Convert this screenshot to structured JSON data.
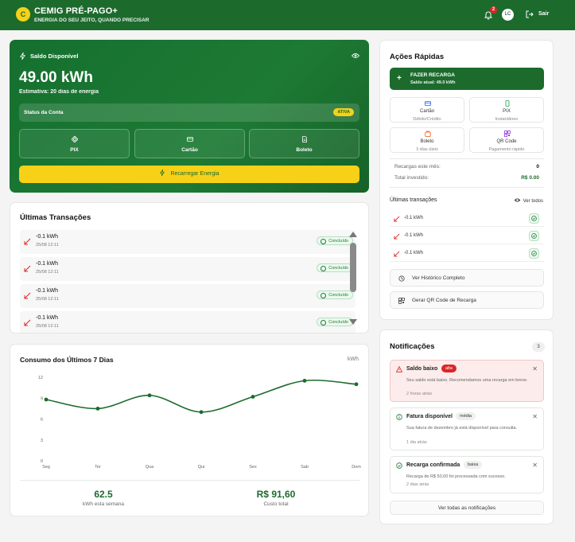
{
  "header": {
    "logo_letter": "C",
    "title": "CEMIG PRÉ-PAGO+",
    "subtitle": "ENERGIA DO SEU JEITO, QUANDO PRECISAR",
    "notification_count": "2",
    "avatar_initials": "LC",
    "logout_label": "Sair"
  },
  "balance": {
    "label": "Saldo Disponível",
    "value": "49.00 kWh",
    "estimate": "Estimativa: 20 dias de energia",
    "status_label": "Status da Conta",
    "status_badge": "ATIVA",
    "payment_buttons": [
      "PIX",
      "Cartão",
      "Boleto"
    ],
    "recharge_label": "Recarregar Energia"
  },
  "transactions": {
    "title": "Últimas Transações",
    "items": [
      {
        "amount": "-0.1 kWh",
        "date": "25/08 12:11",
        "status": "Concluído"
      },
      {
        "amount": "-0.1 kWh",
        "date": "25/08 12:11",
        "status": "Concluído"
      },
      {
        "amount": "-0.1 kWh",
        "date": "25/08 12:11",
        "status": "Concluído"
      },
      {
        "amount": "-0.1 kWh",
        "date": "25/08 12:11",
        "status": "Concluído"
      }
    ]
  },
  "consumption": {
    "title": "Consumo dos Últimos 7 Dias",
    "unit": "kWh",
    "week_total": "62.5",
    "week_total_label": "kWh esta semana",
    "cost_total": "R$ 91,60",
    "cost_total_label": "Custo total"
  },
  "chart_data": {
    "type": "line",
    "title": "Consumo dos Últimos 7 Dias",
    "xlabel": "",
    "ylabel": "kWh",
    "categories": [
      "Seg",
      "Ter",
      "Qua",
      "Qui",
      "Sex",
      "Sab",
      "Dom"
    ],
    "values": [
      8.8,
      7.5,
      9.4,
      7.0,
      9.2,
      11.5,
      11.0
    ],
    "ylim": [
      0,
      12
    ],
    "yticks": [
      "0",
      "3",
      "6",
      "9",
      "12"
    ],
    "grid": false,
    "color": "#1c6b2d"
  },
  "quick_actions": {
    "title": "Ações Rápidas",
    "primary_label": "FAZER RECARGA",
    "primary_sub": "Saldo atual: 49.0 kWh",
    "tiles": [
      {
        "name": "Cartão",
        "sub": "Débito/Crédito",
        "icon": "credit-card-icon"
      },
      {
        "name": "PIX",
        "sub": "Instantâneo",
        "icon": "smartphone-icon"
      },
      {
        "name": "Boleto",
        "sub": "3 dias úteis",
        "icon": "boleto-icon"
      },
      {
        "name": "QR Code",
        "sub": "Pagamento rápido",
        "icon": "qr-code-icon"
      }
    ],
    "monthly_label": "Recargas este mês:",
    "monthly_value": "0",
    "invested_label": "Total investido:",
    "invested_value": "R$ 0.00",
    "recent_label": "Últimas transações",
    "view_all_label": "Ver todos",
    "recent_items": [
      "-0.1 kWh",
      "-0.1 kWh",
      "-0.1 kWh"
    ],
    "history_label": "Ver Histórico Completo",
    "qr_label": "Gerar QR Code de Recarga"
  },
  "notifications": {
    "title": "Notificações",
    "count": "3",
    "items": [
      {
        "title": "Saldo baixo",
        "tag": "alta",
        "body": "Seu saldo está baixo. Recomendamos uma recarga em breve.",
        "time": "2 horas atrás"
      },
      {
        "title": "Fatura disponível",
        "tag": "média",
        "body": "Sua fatura de dezembro já está disponível para consulta.",
        "time": "1 dia atrás"
      },
      {
        "title": "Recarga confirmada",
        "tag": "baixa",
        "body": "Recarga de R$ 50,00 foi processada com sucesso.",
        "time": "2 dias atrás"
      }
    ],
    "view_all_label": "Ver todas as notificações"
  },
  "colors": {
    "brand": "#1c6b2d",
    "accent": "#f7d117",
    "alert": "#dc2626"
  }
}
